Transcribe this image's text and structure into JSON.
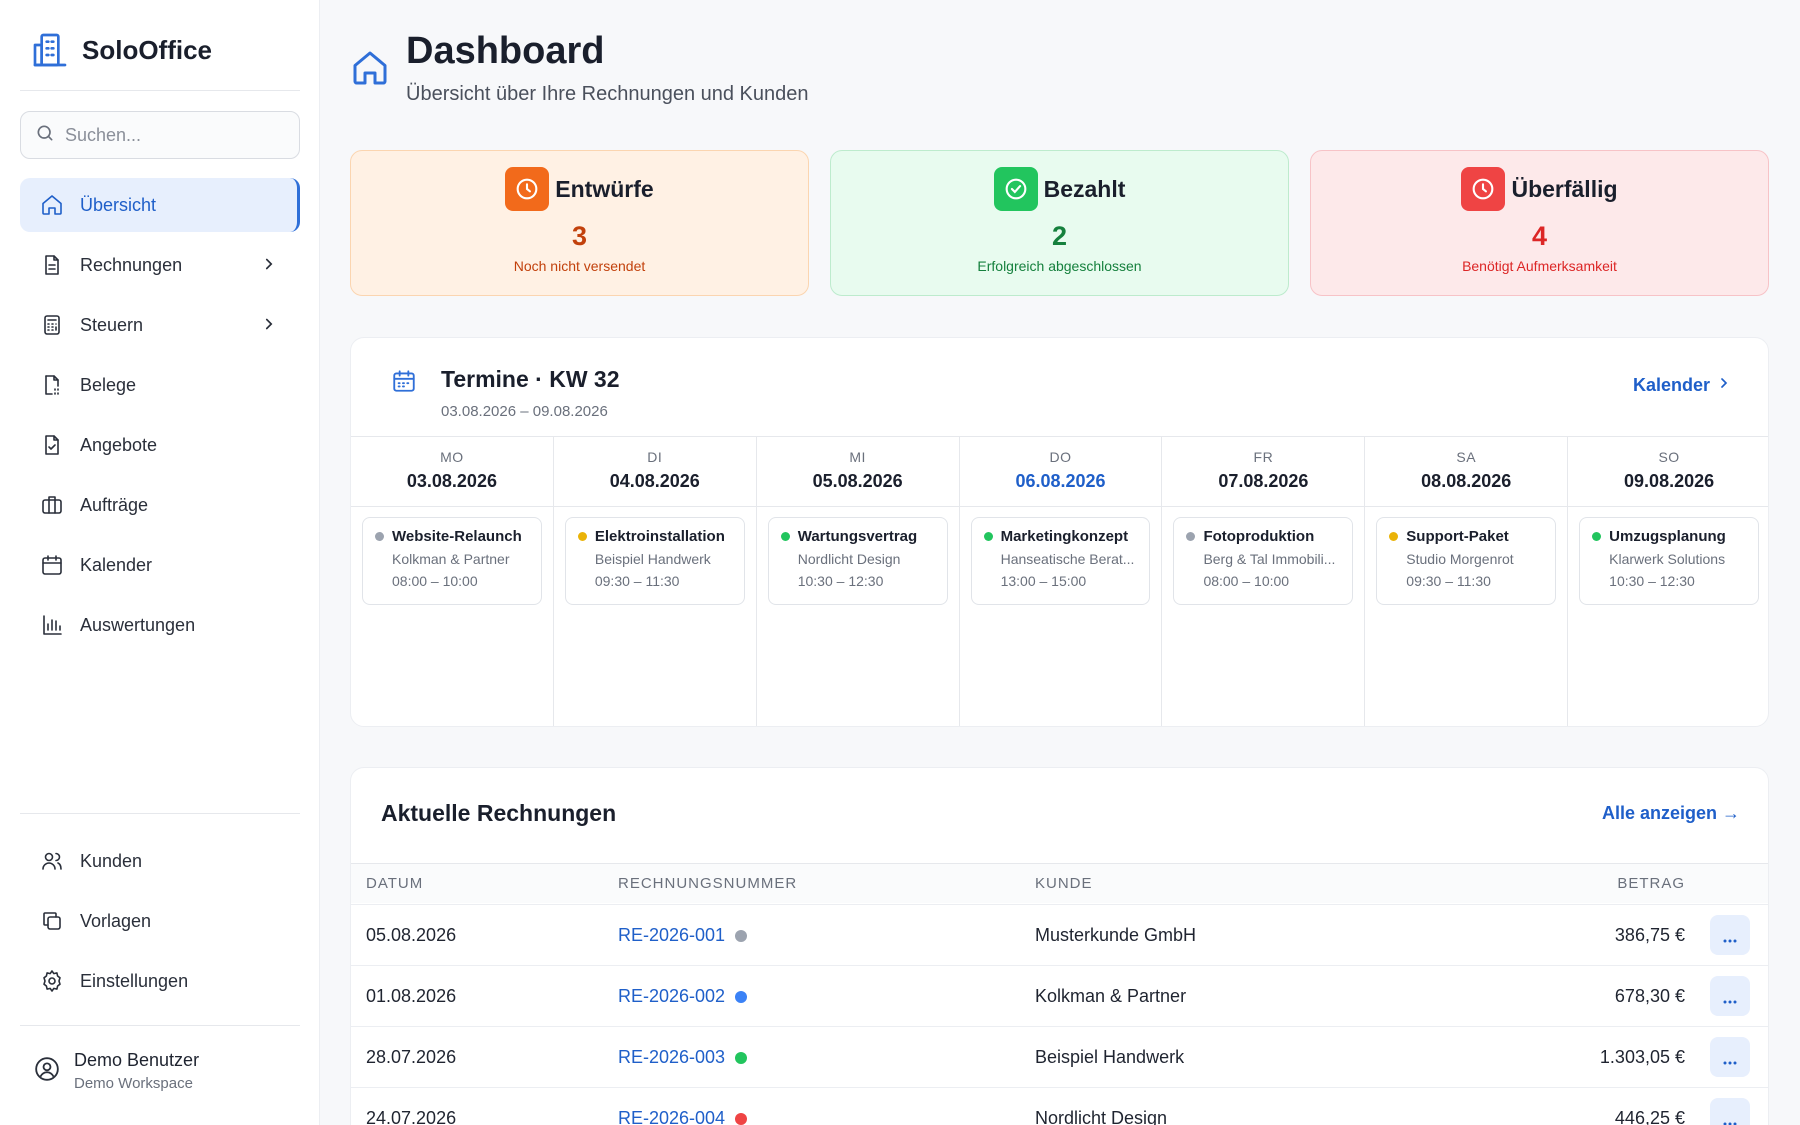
{
  "brand": {
    "name": "SoloOffice"
  },
  "search": {
    "placeholder": "Suchen..."
  },
  "nav": {
    "main": [
      {
        "label": "Übersicht",
        "icon": "home-icon",
        "active": true
      },
      {
        "label": "Rechnungen",
        "icon": "document-icon",
        "has_submenu": true
      },
      {
        "label": "Steuern",
        "icon": "calculator-icon",
        "has_submenu": true
      },
      {
        "label": "Belege",
        "icon": "receipt-icon"
      },
      {
        "label": "Angebote",
        "icon": "document-check-icon"
      },
      {
        "label": "Aufträge",
        "icon": "briefcase-icon"
      },
      {
        "label": "Kalender",
        "icon": "calendar-icon"
      },
      {
        "label": "Auswertungen",
        "icon": "bar-chart-icon"
      }
    ],
    "bottom": [
      {
        "label": "Kunden",
        "icon": "users-icon"
      },
      {
        "label": "Vorlagen",
        "icon": "copy-icon"
      },
      {
        "label": "Einstellungen",
        "icon": "gear-icon"
      }
    ]
  },
  "user": {
    "name": "Demo Benutzer",
    "workspace": "Demo Workspace"
  },
  "header": {
    "title": "Dashboard",
    "subtitle": "Übersicht über Ihre Rechnungen und Kunden"
  },
  "stats": [
    {
      "label": "Entwürfe",
      "count": "3",
      "description": "Noch nicht versendet",
      "icon": "clock-icon",
      "accent": "#f26a1b",
      "text_color": "#c2410c",
      "bg": "#fff1e4",
      "border": "#fbd5b0"
    },
    {
      "label": "Bezahlt",
      "count": "2",
      "description": "Erfolgreich abgeschlossen",
      "icon": "check-circle-icon",
      "accent": "#22c55e",
      "text_color": "#15803d",
      "bg": "#e8fbef",
      "border": "#bdebcd"
    },
    {
      "label": "Überfällig",
      "count": "4",
      "description": "Benötigt Aufmerksamkeit",
      "icon": "clock-alert-icon",
      "accent": "#ef4444",
      "text_color": "#dc2626",
      "bg": "#fde9ea",
      "border": "#f7c3c7"
    }
  ],
  "termine": {
    "title": "Termine · KW 32",
    "range": "03.08.2026 – 09.08.2026",
    "link": "Kalender",
    "days": [
      {
        "name": "MO",
        "date": "03.08.2026",
        "event": {
          "title": "Website-Relaunch",
          "client": "Kolkman & Partner",
          "time": "08:00 – 10:00",
          "dot": "#9ca3af"
        }
      },
      {
        "name": "DI",
        "date": "04.08.2026",
        "event": {
          "title": "Elektroinstallation",
          "client": "Beispiel Handwerk",
          "time": "09:30 – 11:30",
          "dot": "#eab308"
        }
      },
      {
        "name": "MI",
        "date": "05.08.2026",
        "event": {
          "title": "Wartungsvertrag",
          "client": "Nordlicht Design",
          "time": "10:30 – 12:30",
          "dot": "#22c55e"
        }
      },
      {
        "name": "DO",
        "date": "06.08.2026",
        "today": true,
        "event": {
          "title": "Marketingkonzept",
          "client": "Hanseatische Berat...",
          "time": "13:00 – 15:00",
          "dot": "#22c55e"
        }
      },
      {
        "name": "FR",
        "date": "07.08.2026",
        "event": {
          "title": "Fotoproduktion",
          "client": "Berg & Tal Immobili...",
          "time": "08:00 – 10:00",
          "dot": "#9ca3af"
        }
      },
      {
        "name": "SA",
        "date": "08.08.2026",
        "event": {
          "title": "Support-Paket",
          "client": "Studio Morgenrot",
          "time": "09:30 – 11:30",
          "dot": "#eab308"
        }
      },
      {
        "name": "SO",
        "date": "09.08.2026",
        "event": {
          "title": "Umzugsplanung",
          "client": "Klarwerk Solutions",
          "time": "10:30 – 12:30",
          "dot": "#22c55e"
        }
      }
    ]
  },
  "invoices": {
    "title": "Aktuelle Rechnungen",
    "link": "Alle anzeigen →",
    "columns": [
      "DATUM",
      "RECHNUNGSNUMMER",
      "KUNDE",
      "BETRAG"
    ],
    "rows": [
      {
        "date": "05.08.2026",
        "number": "RE-2026-001",
        "status_color": "#9ca3af",
        "customer": "Musterkunde GmbH",
        "amount": "386,75 €"
      },
      {
        "date": "01.08.2026",
        "number": "RE-2026-002",
        "status_color": "#3b82f6",
        "customer": "Kolkman & Partner",
        "amount": "678,30 €"
      },
      {
        "date": "28.07.2026",
        "number": "RE-2026-003",
        "status_color": "#22c55e",
        "customer": "Beispiel Handwerk",
        "amount": "1.303,05 €"
      },
      {
        "date": "24.07.2026",
        "number": "RE-2026-004",
        "status_color": "#ef4444",
        "customer": "Nordlicht Design",
        "amount": "446,25 €"
      }
    ]
  },
  "colors": {
    "primary": "#1f5fc9",
    "active_bg": "#e7effd"
  }
}
